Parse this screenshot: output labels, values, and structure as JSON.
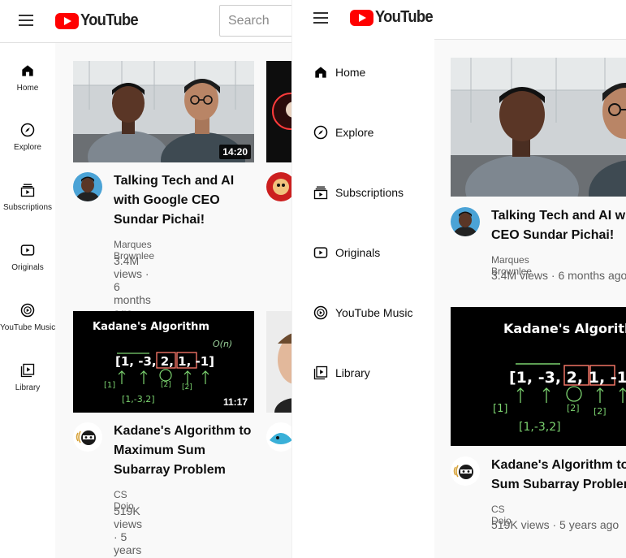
{
  "app": {
    "logo_text": "YouTube"
  },
  "search": {
    "placeholder": "Search"
  },
  "mini_nav": [
    {
      "label": "Home",
      "icon": "home-icon"
    },
    {
      "label": "Explore",
      "icon": "compass-icon"
    },
    {
      "label": "Subscriptions",
      "icon": "subscriptions-icon"
    },
    {
      "label": "Originals",
      "icon": "originals-icon"
    },
    {
      "label": "YouTube Music",
      "icon": "music-icon"
    },
    {
      "label": "Library",
      "icon": "library-icon"
    }
  ],
  "guide": [
    {
      "label": "Home",
      "icon": "home-icon"
    },
    {
      "label": "Explore",
      "icon": "compass-icon"
    },
    {
      "label": "Subscriptions",
      "icon": "subscriptions-icon"
    },
    {
      "label": "Originals",
      "icon": "originals-icon"
    },
    {
      "label": "YouTube Music",
      "icon": "music-icon"
    },
    {
      "label": "Library",
      "icon": "library-icon"
    }
  ],
  "videos": [
    {
      "title": "Talking Tech and AI with Google CEO Sundar Pichai!",
      "title_left": [
        "Talking Tech and AI",
        "with Google CEO",
        "Sundar Pichai!"
      ],
      "title_right": [
        "Talking Tech and AI wit",
        "CEO Sundar Pichai!"
      ],
      "channel": "Marques Brownlee",
      "meta": "3.4M views · 6 months ago",
      "duration": "14:20"
    },
    {
      "title": "Kadane's Algorithm to Maximum Sum Subarray Problem",
      "title_left": [
        "Kadane's Algorithm to",
        "Maximum Sum",
        "Subarray Problem"
      ],
      "title_right": [
        "Kadane's Algorithm to M",
        "Sum Subarray Problem"
      ],
      "channel": "CS Dojo",
      "meta": "519K views · 5 years ago",
      "duration": "11:17",
      "thumb_text": {
        "heading": "Kadane's Algorithm",
        "array": "[1, -3, 2, 1, -1]",
        "sub1": "[1]",
        "sub2": "[2]",
        "sub3": "[2]",
        "sub4": "[1,-3,2]",
        "note": "O(n)"
      }
    }
  ],
  "colors": {
    "brand_red": "#ff0000",
    "page_bg": "#f9f9f9",
    "meta_text": "#606060"
  }
}
